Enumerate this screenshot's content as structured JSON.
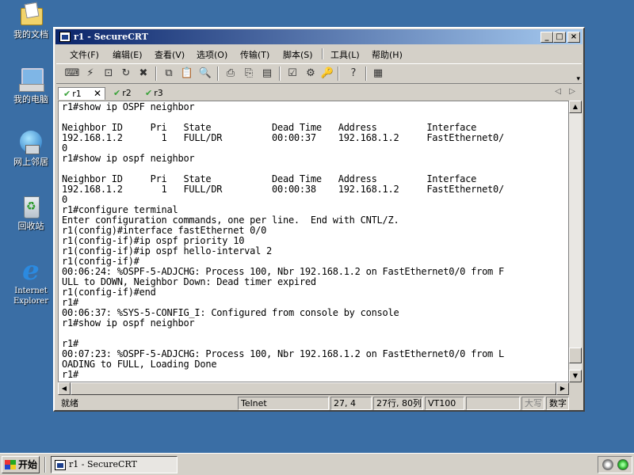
{
  "desktop": {
    "icons": [
      {
        "label": "我的文档",
        "icon": "my-documents-icon"
      },
      {
        "label": "我的电脑",
        "icon": "my-computer-icon"
      },
      {
        "label": "网上邻居",
        "icon": "network-places-icon"
      },
      {
        "label": "回收站",
        "icon": "recycle-bin-icon"
      },
      {
        "label": "Internet Explorer",
        "icon": "internet-explorer-icon"
      }
    ]
  },
  "window": {
    "title": "r1 - SecureCRT",
    "menu": [
      "文件(F)",
      "编辑(E)",
      "查看(V)",
      "选项(O)",
      "传输(T)",
      "脚本(S)",
      "工具(L)",
      "帮助(H)"
    ],
    "toolbar_icons": [
      "connect-icon",
      "quick-connect-icon",
      "connect-tab-icon",
      "reconnect-icon",
      "disconnect-icon",
      "copy-icon",
      "paste-icon",
      "find-icon",
      "print-icon",
      "print-selection-icon",
      "print-setup-icon",
      "session-options-icon",
      "global-options-icon",
      "keymap-icon",
      "help-icon",
      "about-icon"
    ],
    "tabs": [
      {
        "label": "r1",
        "active": true
      },
      {
        "label": "r2",
        "active": false
      },
      {
        "label": "r3",
        "active": false
      }
    ],
    "terminal_lines": [
      "r1#show ip OSPF neighbor",
      "",
      "Neighbor ID     Pri   State           Dead Time   Address         Interface",
      "192.168.1.2       1   FULL/DR         00:00:37    192.168.1.2     FastEthernet0/",
      "0",
      "r1#show ip ospf neighbor",
      "",
      "Neighbor ID     Pri   State           Dead Time   Address         Interface",
      "192.168.1.2       1   FULL/DR         00:00:38    192.168.1.2     FastEthernet0/",
      "0",
      "r1#configure terminal",
      "Enter configuration commands, one per line.  End with CNTL/Z.",
      "r1(config)#interface fastEthernet 0/0",
      "r1(config-if)#ip ospf priority 10",
      "r1(config-if)#ip ospf hello-interval 2",
      "r1(config-if)#",
      "00:06:24: %OSPF-5-ADJCHG: Process 100, Nbr 192.168.1.2 on FastEthernet0/0 from F",
      "ULL to DOWN, Neighbor Down: Dead timer expired",
      "r1(config-if)#end",
      "r1#",
      "00:06:37: %SYS-5-CONFIG_I: Configured from console by console",
      "r1#show ip ospf neighbor",
      "",
      "r1#",
      "00:07:23: %OSPF-5-ADJCHG: Process 100, Nbr 192.168.1.2 on FastEthernet0/0 from L",
      "OADING to FULL, Loading Done",
      "r1#"
    ],
    "status": {
      "ready": "就绪",
      "protocol": "Telnet",
      "cursor": "27, 4",
      "size": "27行, 80列",
      "emulation": "VT100",
      "caps": "大写",
      "num": "数字"
    }
  },
  "taskbar": {
    "start_label": "开始",
    "task_label": "r1 - SecureCRT"
  }
}
